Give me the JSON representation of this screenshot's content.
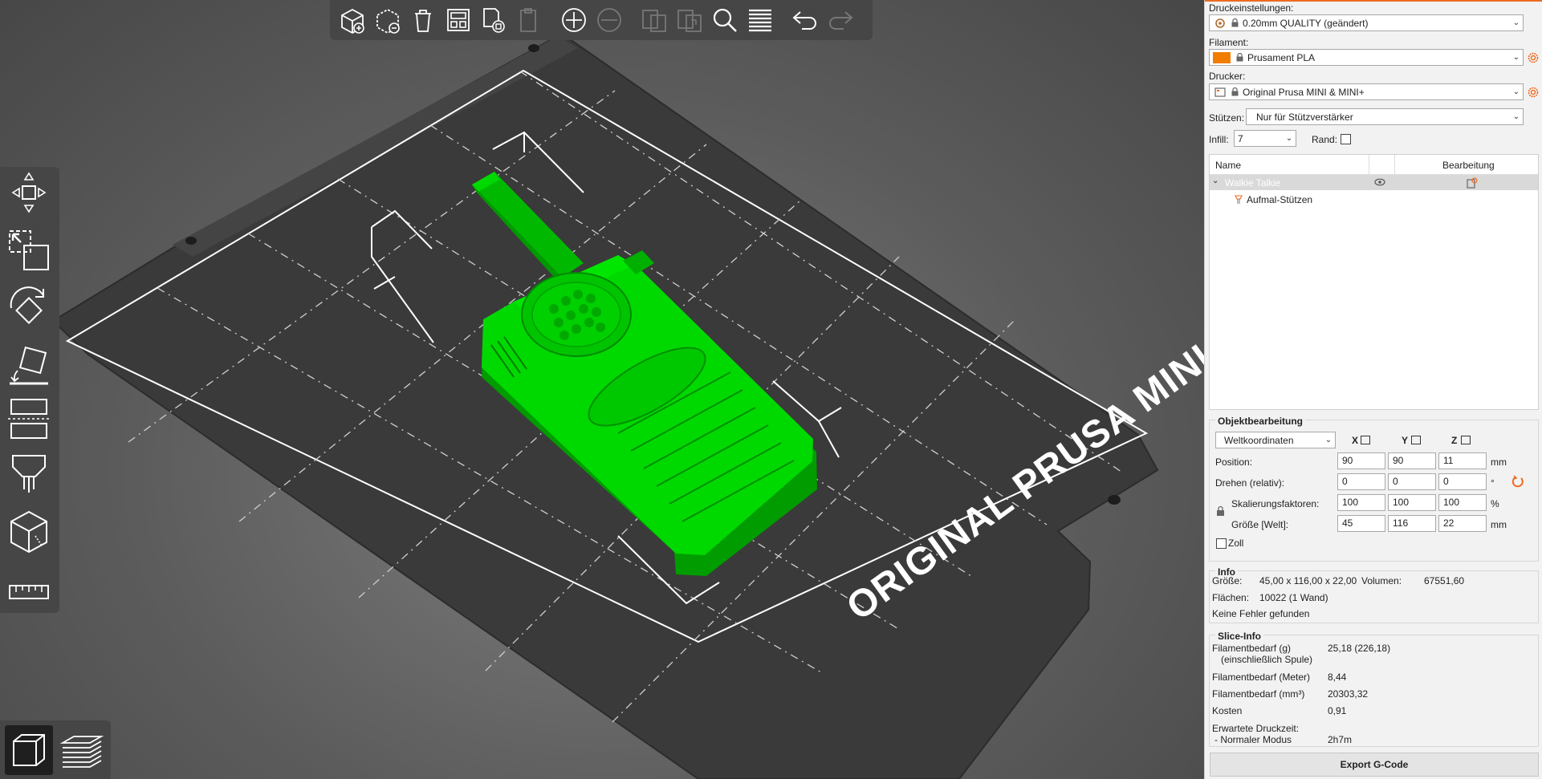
{
  "app": {
    "accent_color": "#ed6b21",
    "object_color": "#00d900"
  },
  "bed": {
    "title": "ORIGINAL PRUSA MINI"
  },
  "top_toolbar": {
    "icons": [
      "add-icon",
      "delete-icon",
      "delete-all-icon",
      "arrange-icon",
      "copy-icon",
      "paste-icon",
      "add-instance-icon",
      "remove-instance-icon",
      "split-to-objects-icon",
      "split-to-parts-icon",
      "search-icon",
      "layers-editing-icon",
      "undo-icon",
      "redo-icon"
    ]
  },
  "left_toolbar": {
    "icons": [
      "move-icon",
      "scale-icon",
      "rotate-icon",
      "place-on-face-icon",
      "cut-icon",
      "paint-supports-icon",
      "seam-painting-icon",
      "measure-icon"
    ]
  },
  "view_toggle": {
    "icons": [
      "3d-view-icon",
      "preview-layers-icon"
    ]
  },
  "sidebar": {
    "print_settings_label": "Druckeinstellungen:",
    "print_settings_value": "0.20mm QUALITY (geändert)",
    "filament_label": "Filament:",
    "filament_value": "Prusament PLA",
    "filament_color": "#f07d00",
    "printer_label": "Drucker:",
    "printer_value": "Original Prusa MINI & MINI+",
    "supports_label": "Stützen:",
    "supports_value": "Nur für Stützverstärker",
    "infill_label": "Infill:",
    "infill_value": "7",
    "brim_label": "Rand:",
    "list": {
      "col_name": "Name",
      "col_edit": "Bearbeitung",
      "rows": [
        {
          "name": "Walkie Talkie",
          "level": 0
        },
        {
          "name": "Aufmal-Stützen",
          "level": 1
        }
      ]
    },
    "object_manipulation": {
      "title": "Objektbearbeitung",
      "coords_value": "Weltkoordinaten",
      "axis_x": "X",
      "axis_y": "Y",
      "axis_z": "Z",
      "position_label": "Position:",
      "position": [
        "90",
        "90",
        "11"
      ],
      "position_unit": "mm",
      "rotate_label": "Drehen (relativ):",
      "rotate": [
        "0",
        "0",
        "0"
      ],
      "rotate_unit": "°",
      "scale_label": "Skalierungsfaktoren:",
      "scale": [
        "100",
        "100",
        "100"
      ],
      "scale_unit": "%",
      "size_label": "Größe [Welt]:",
      "size": [
        "45",
        "116",
        "22"
      ],
      "size_unit": "mm",
      "inches_label": "Zoll"
    },
    "info": {
      "title": "Info",
      "size_label": "Größe:",
      "size_value": "45,00 x 116,00 x 22,00",
      "volume_label": "Volumen:",
      "volume_value": "67551,60",
      "facets_label": "Flächen:",
      "facets_value": "10022 (1 Wand)",
      "errors": "Keine Fehler gefunden"
    },
    "slice_info": {
      "title": "Slice-Info",
      "filament_g_label": "Filamentbedarf (g)",
      "filament_g_sub": "(einschließlich Spule)",
      "filament_g_value": "25,18 (226,18)",
      "filament_m_label": "Filamentbedarf (Meter)",
      "filament_m_value": "8,44",
      "filament_mm3_label": "Filamentbedarf (mm³)",
      "filament_mm3_value": "20303,32",
      "cost_label": "Kosten",
      "cost_value": "0,91",
      "print_time_label": "Erwartete Druckzeit:",
      "normal_mode_label": "- Normaler Modus",
      "normal_mode_value": "2h7m"
    },
    "export_label": "Export G-Code"
  }
}
